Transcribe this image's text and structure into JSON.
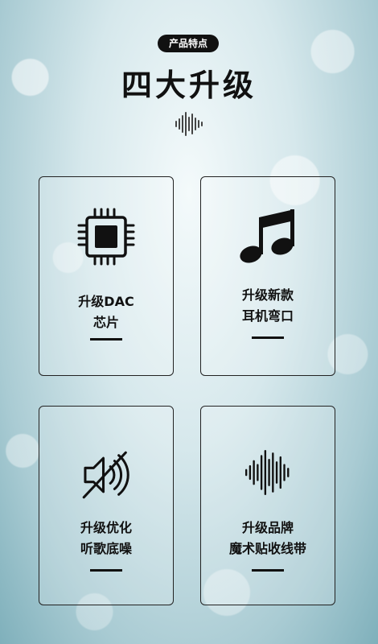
{
  "header": {
    "badge": "产品特点",
    "title": "四大升级"
  },
  "cards": [
    {
      "line1": "升级DAC",
      "line2": "芯片",
      "icon": "chip-icon"
    },
    {
      "line1": "升级新款",
      "line2": "耳机弯口",
      "icon": "music-note-icon"
    },
    {
      "line1": "升级优化",
      "line2": "听歌底噪",
      "icon": "speaker-mute-icon"
    },
    {
      "line1": "升级品牌",
      "line2": "魔术贴收线带",
      "icon": "sound-wave-icon"
    }
  ]
}
